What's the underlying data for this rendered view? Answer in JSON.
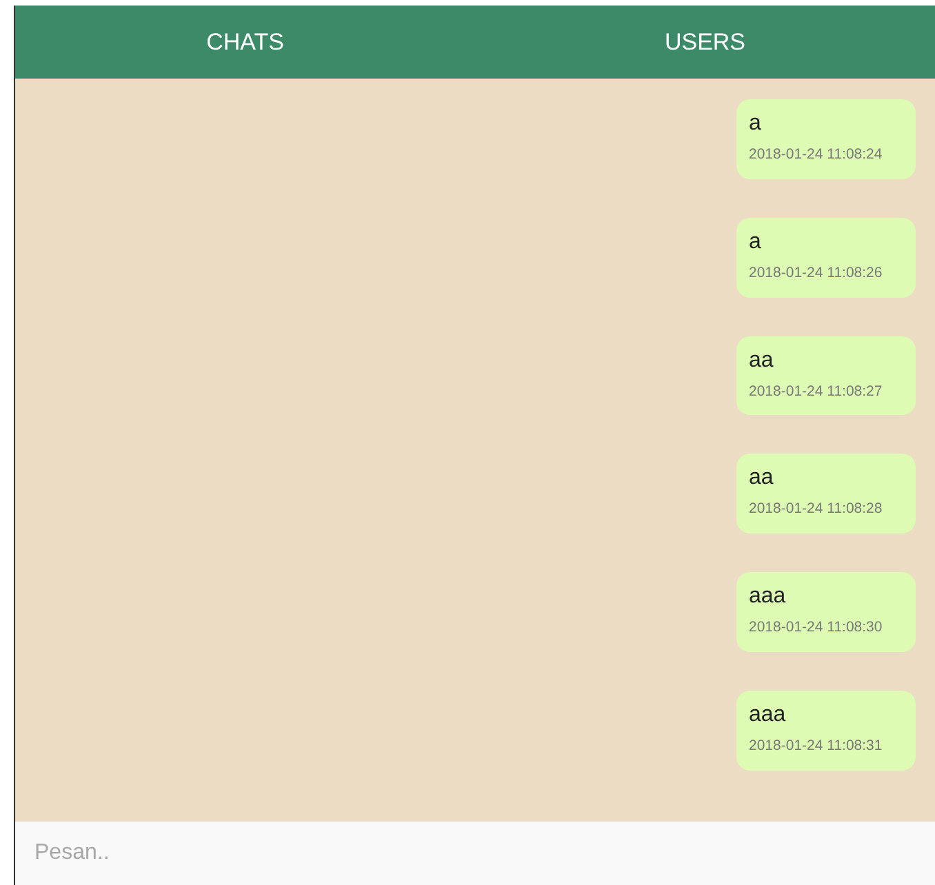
{
  "tabs": [
    {
      "label": "CHATS"
    },
    {
      "label": "USERS"
    }
  ],
  "messages": [
    {
      "text": "a",
      "time": "2018-01-24 11:08:24"
    },
    {
      "text": "a",
      "time": "2018-01-24 11:08:26"
    },
    {
      "text": "aa",
      "time": "2018-01-24 11:08:27"
    },
    {
      "text": "aa",
      "time": "2018-01-24 11:08:28"
    },
    {
      "text": "aaa",
      "time": "2018-01-24 11:08:30"
    },
    {
      "text": "aaa",
      "time": "2018-01-24 11:08:31"
    }
  ],
  "composer": {
    "placeholder": "Pesan.."
  }
}
